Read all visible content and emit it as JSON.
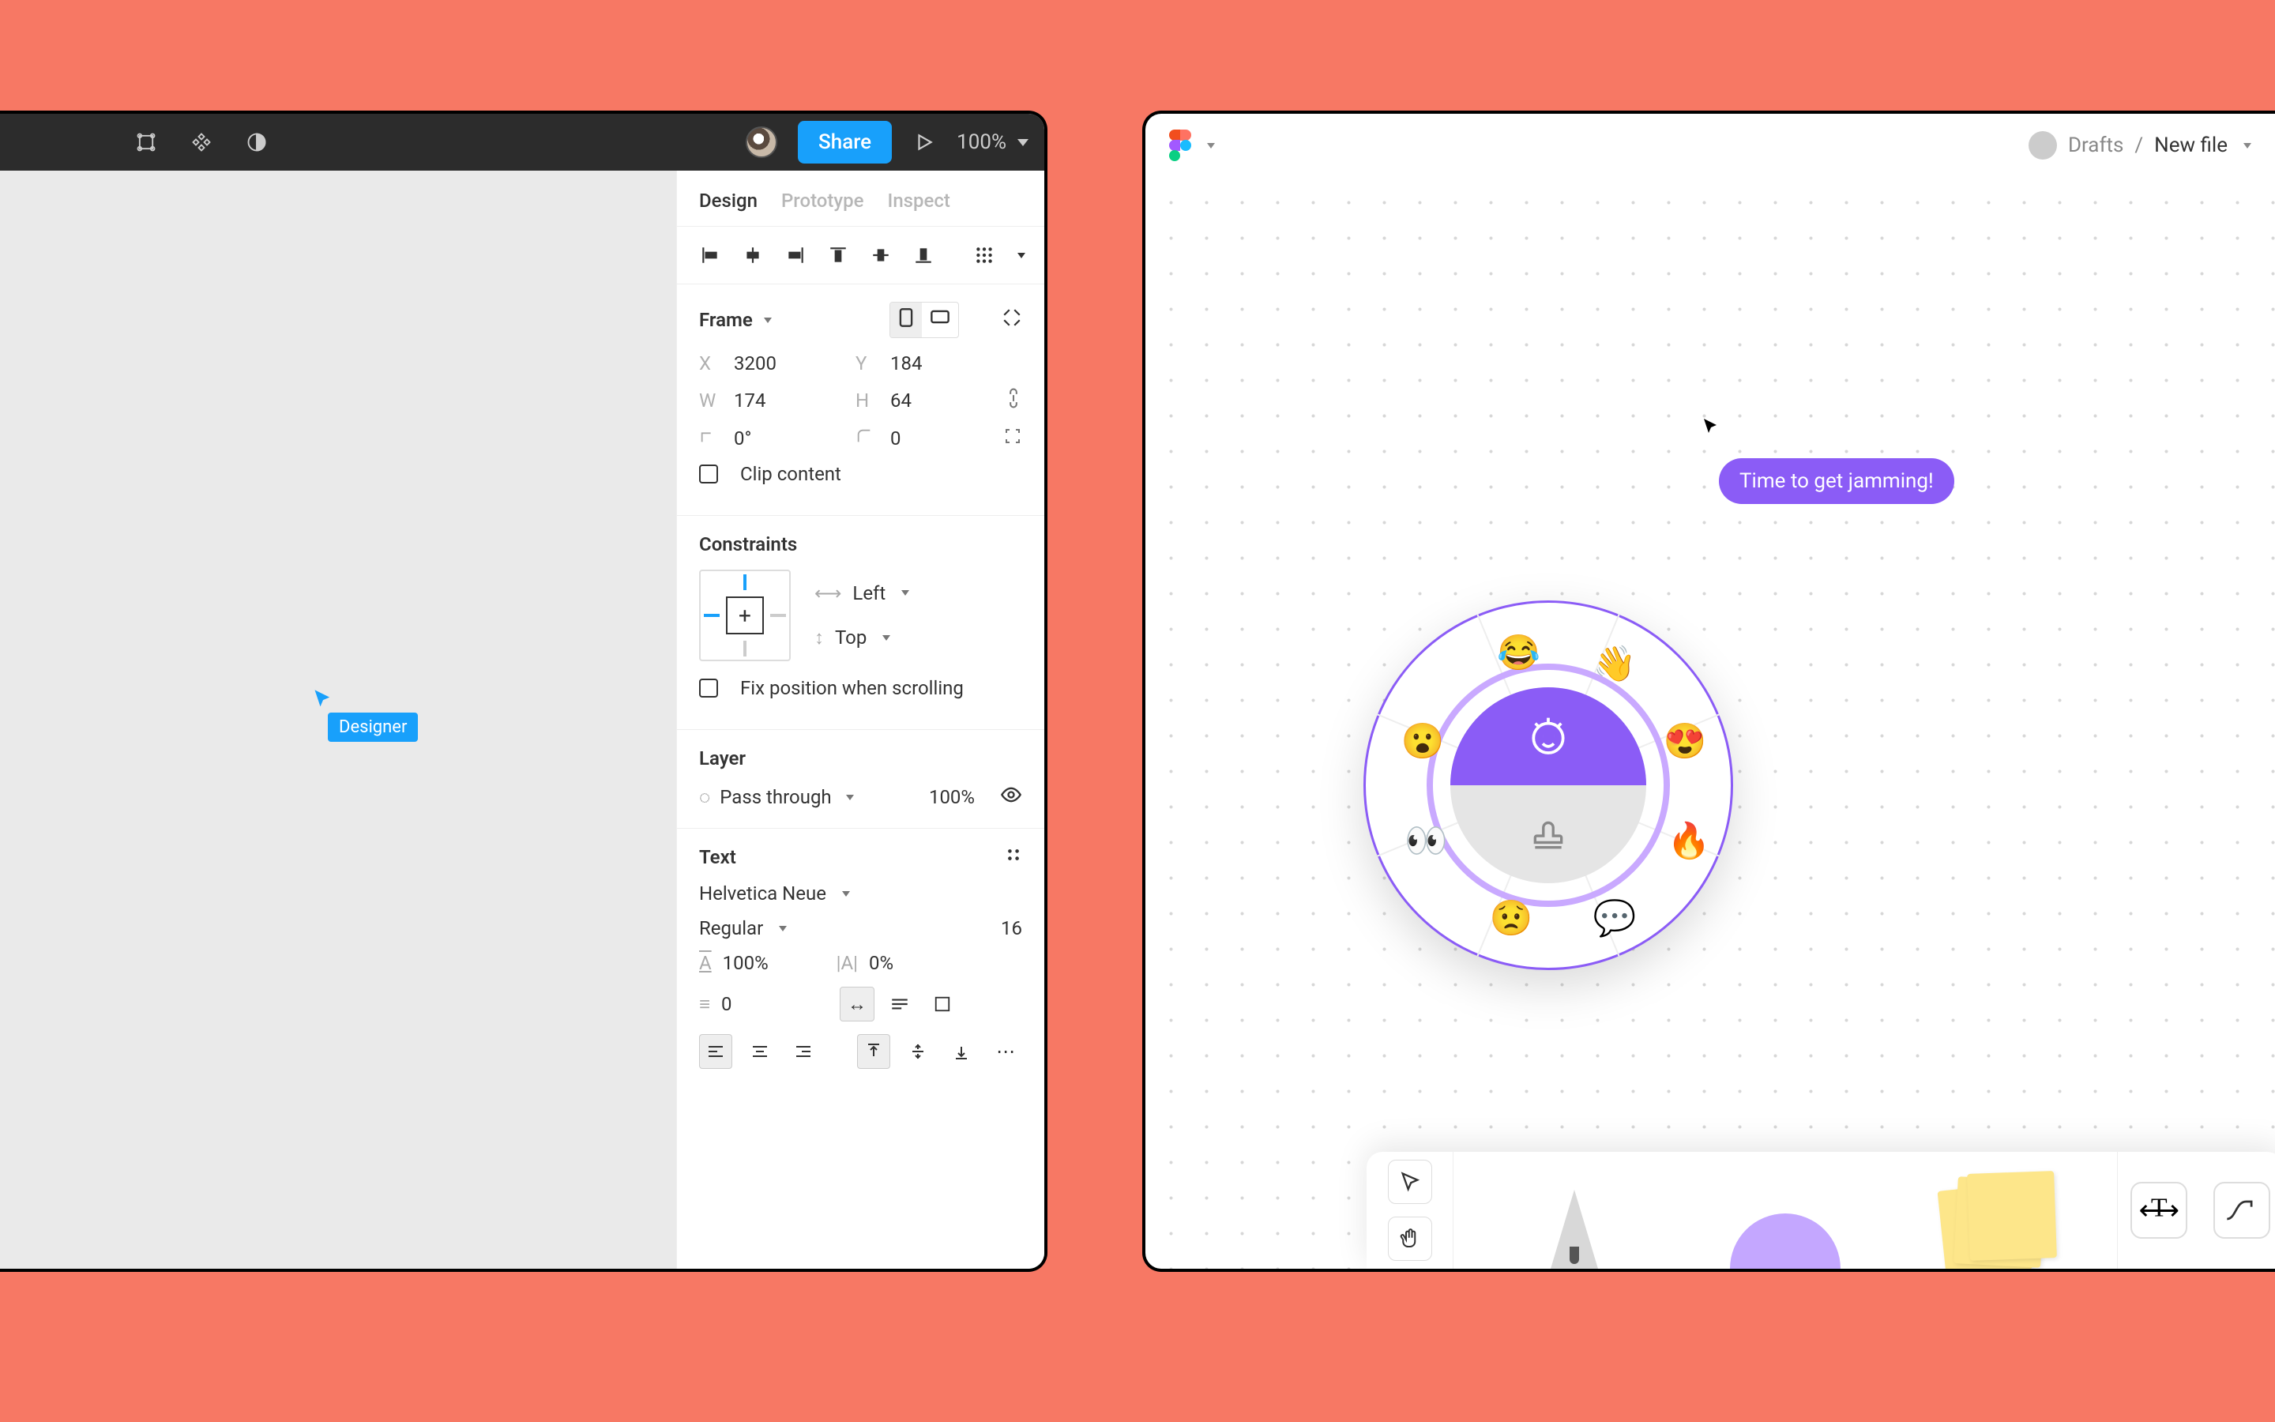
{
  "figma": {
    "toolbar": {
      "share_label": "Share",
      "zoom": "100%"
    },
    "cursor_tag": "Designer",
    "panel": {
      "tabs": {
        "design": "Design",
        "prototype": "Prototype",
        "inspect": "Inspect"
      },
      "frame": {
        "title": "Frame",
        "x_label": "X",
        "x": "3200",
        "y_label": "Y",
        "y": "184",
        "w_label": "W",
        "w": "174",
        "h_label": "H",
        "h": "64",
        "rotation": "0°",
        "corner": "0",
        "clip": "Clip content"
      },
      "constraints": {
        "title": "Constraints",
        "h": "Left",
        "v": "Top",
        "fix": "Fix position when scrolling"
      },
      "layer": {
        "title": "Layer",
        "blend": "Pass through",
        "opacity": "100%"
      },
      "text": {
        "title": "Text",
        "font": "Helvetica Neue",
        "weight": "Regular",
        "size": "16",
        "line_height": "100%",
        "letter_spacing": "0%",
        "paragraph": "0"
      }
    }
  },
  "figjam": {
    "breadcrumb": {
      "drafts": "Drafts",
      "file": "New file"
    },
    "message": "Time to get jamming!",
    "wheel_emojis": [
      "😂",
      "👋",
      "😍",
      "🔥",
      "💬",
      "😟",
      "👀",
      "😮"
    ],
    "toolbar_text_icon": "T"
  }
}
